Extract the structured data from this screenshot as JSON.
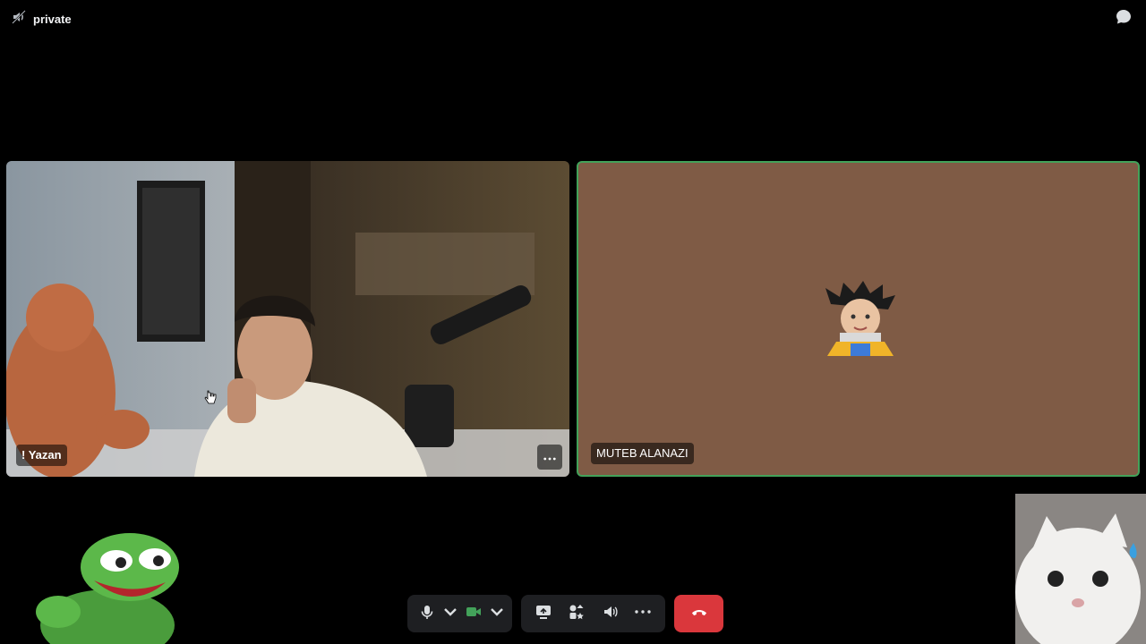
{
  "header": {
    "channel_icon": "speaker-icon",
    "channel_name": "private",
    "chat_icon": "chat-bubble-icon"
  },
  "participants": [
    {
      "name": "! Yazan",
      "tile_bg": "#2a241c"
    },
    {
      "name": "MUTEB ALANAZI",
      "tile_bg": "#7f5b45",
      "speaking_border": "#43a25a"
    }
  ],
  "controls": {
    "mic_icon": "microphone-icon",
    "camera_icon": "video-camera-icon",
    "screen_share_icon": "screen-share-icon",
    "activities_icon": "activities-icon",
    "soundboard_icon": "soundboard-icon",
    "more_icon": "more-icon",
    "hangup_icon": "hang-up-icon",
    "camera_color": "#43a25a",
    "hangup_color": "#da373c"
  }
}
